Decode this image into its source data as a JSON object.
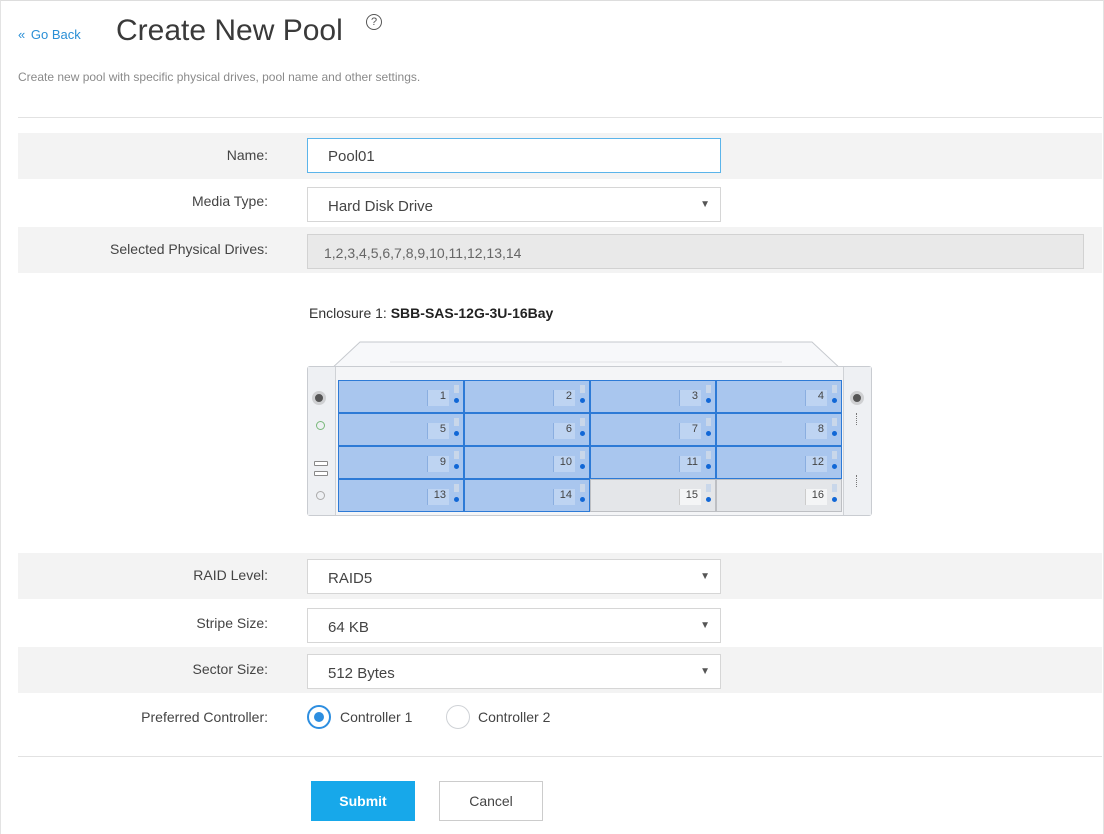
{
  "header": {
    "go_back_label": "Go Back",
    "go_back_icon": "double-chevron-left-icon",
    "title": "Create New Pool",
    "help_icon": "question-circle-icon",
    "subtitle": "Create new pool with specific physical drives, pool name and other settings."
  },
  "form": {
    "name": {
      "label": "Name:",
      "value": "Pool01"
    },
    "media_type": {
      "label": "Media Type:",
      "value": "Hard Disk Drive"
    },
    "selected_drives": {
      "label": "Selected Physical Drives:",
      "value": "1,2,3,4,5,6,7,8,9,10,11,12,13,14"
    },
    "raid_level": {
      "label": "RAID Level:",
      "value": "RAID5"
    },
    "stripe_size": {
      "label": "Stripe Size:",
      "value": "64 KB"
    },
    "sector_size": {
      "label": "Sector Size:",
      "value": "512 Bytes"
    },
    "preferred_controller": {
      "label": "Preferred Controller:",
      "options": [
        "Controller 1",
        "Controller 2"
      ],
      "selected": "Controller 1"
    }
  },
  "enclosure": {
    "label": "Enclosure 1:",
    "model": "SBB-SAS-12G-3U-16Bay",
    "bays": [
      {
        "num": "1",
        "selected": true
      },
      {
        "num": "2",
        "selected": true
      },
      {
        "num": "3",
        "selected": true
      },
      {
        "num": "4",
        "selected": true
      },
      {
        "num": "5",
        "selected": true
      },
      {
        "num": "6",
        "selected": true
      },
      {
        "num": "7",
        "selected": true
      },
      {
        "num": "8",
        "selected": true
      },
      {
        "num": "9",
        "selected": true
      },
      {
        "num": "10",
        "selected": true
      },
      {
        "num": "11",
        "selected": true
      },
      {
        "num": "12",
        "selected": true
      },
      {
        "num": "13",
        "selected": true
      },
      {
        "num": "14",
        "selected": true
      },
      {
        "num": "15",
        "selected": false
      },
      {
        "num": "16",
        "selected": false
      }
    ]
  },
  "buttons": {
    "submit": "Submit",
    "cancel": "Cancel"
  },
  "colors": {
    "accent": "#17a8ea",
    "link": "#2a8fd6",
    "bay_selected": "#a9c6ee",
    "bay_border": "#2d7ad6"
  }
}
